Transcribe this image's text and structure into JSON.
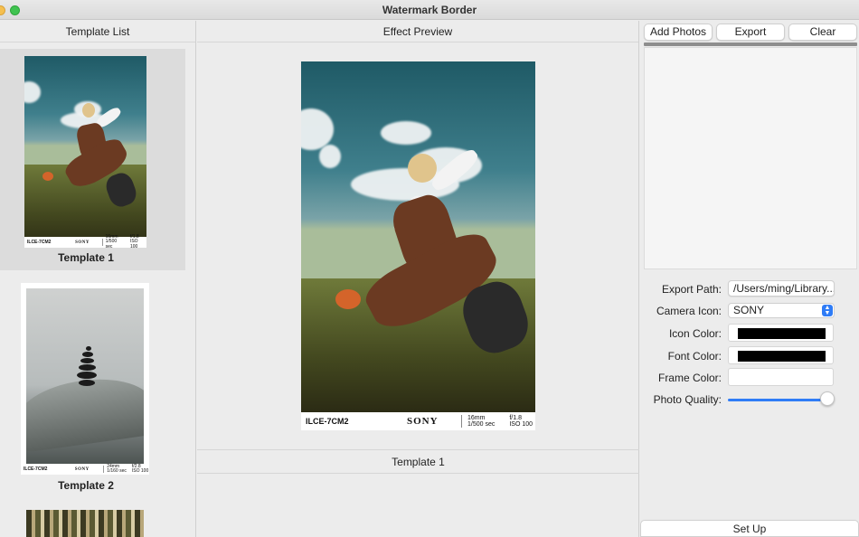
{
  "window": {
    "title": "Watermark Border"
  },
  "left_panel": {
    "header": "Template List",
    "templates": [
      {
        "label": "Template 1",
        "selected": true,
        "watermark": {
          "model": "ILCE-7CM2",
          "brand": "SONY",
          "lens": [
            "16mm",
            "1/500 sec"
          ],
          "exposure": [
            "f/1.8",
            "ISO 100"
          ]
        }
      },
      {
        "label": "Template 2",
        "selected": false,
        "watermark": {
          "model": "ILCE-7CM2",
          "brand": "SONY",
          "lens": [
            "24mm",
            "1/160 sec"
          ],
          "exposure": [
            "f/2.8",
            "ISO 100"
          ]
        }
      },
      {
        "label": "",
        "selected": false
      }
    ]
  },
  "center_panel": {
    "header": "Effect Preview",
    "preview_watermark": {
      "model": "ILCE-7CM2",
      "brand": "SONY",
      "lens": [
        "16mm",
        "1/500 sec"
      ],
      "exposure": [
        "f/1.8",
        "ISO 100"
      ]
    },
    "caption": "Template 1"
  },
  "right_panel": {
    "buttons": {
      "add_photos": "Add Photos",
      "export": "Export",
      "clear": "Clear"
    },
    "settings": {
      "export_path_label": "Export Path:",
      "export_path_value": "/Users/ming/Library...",
      "camera_icon_label": "Camera Icon:",
      "camera_icon_value": "SONY",
      "icon_color_label": "Icon Color:",
      "icon_color_value": "#000000",
      "font_color_label": "Font Color:",
      "font_color_value": "#000000",
      "frame_color_label": "Frame Color:",
      "frame_color_value": "#FFFFFF",
      "photo_quality_label": "Photo Quality:",
      "photo_quality_value": 1.0
    },
    "setup_button": "Set Up"
  },
  "colors": {
    "accent": "#2F7CF6",
    "slider_track": "#2F7CF6"
  }
}
